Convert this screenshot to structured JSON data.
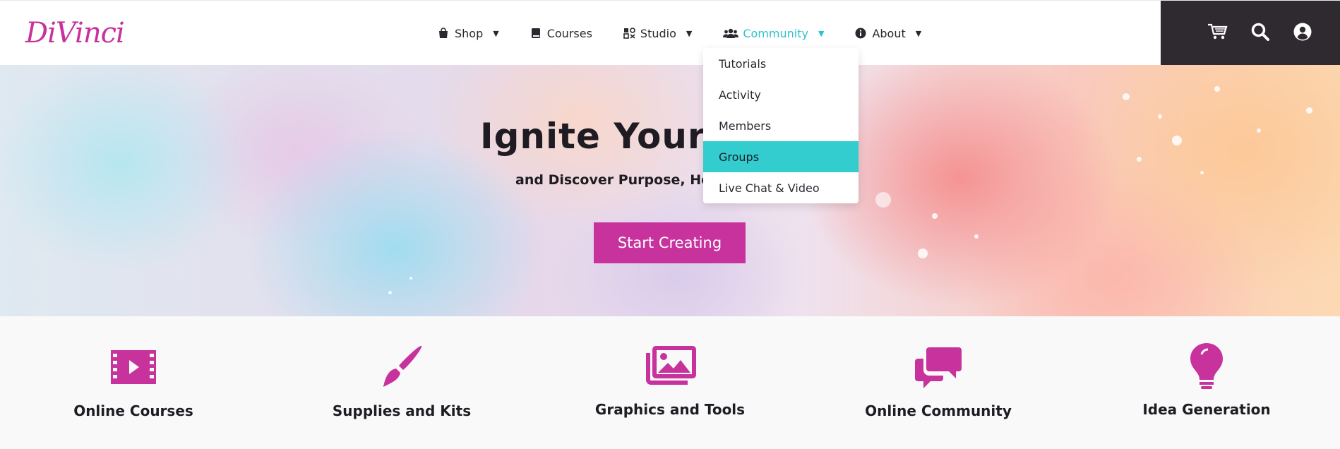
{
  "brand": {
    "logo_text": "DiVinci",
    "accent_color": "#c7329c",
    "highlight_color": "#33cccf"
  },
  "nav": [
    {
      "label": "Shop",
      "icon": "shopping-bag-icon",
      "has_caret": true
    },
    {
      "label": "Courses",
      "icon": "book-icon",
      "has_caret": false
    },
    {
      "label": "Studio",
      "icon": "studio-icon",
      "has_caret": true
    },
    {
      "label": "Community",
      "icon": "users-icon",
      "has_caret": true,
      "active": true
    },
    {
      "label": "About",
      "icon": "info-icon",
      "has_caret": true
    }
  ],
  "caret": "▼",
  "utility_icons": [
    "cart-icon",
    "search-icon",
    "user-account-icon"
  ],
  "dropdown": {
    "items": [
      "Tutorials",
      "Activity",
      "Members",
      "Groups",
      "Live Chat & Video"
    ],
    "highlighted": "Groups"
  },
  "hero": {
    "title": "Ignite Your C",
    "subtitle": "and Discover Purpose, Hea",
    "cta_label": "Start Creating"
  },
  "features": [
    {
      "label": "Online Courses",
      "icon": "video-film-icon"
    },
    {
      "label": "Supplies and Kits",
      "icon": "paintbrush-icon"
    },
    {
      "label": "Graphics and Tools",
      "icon": "images-icon"
    },
    {
      "label": "Online Community",
      "icon": "chat-bubbles-icon"
    },
    {
      "label": "Idea Generation",
      "icon": "lightbulb-icon"
    }
  ]
}
